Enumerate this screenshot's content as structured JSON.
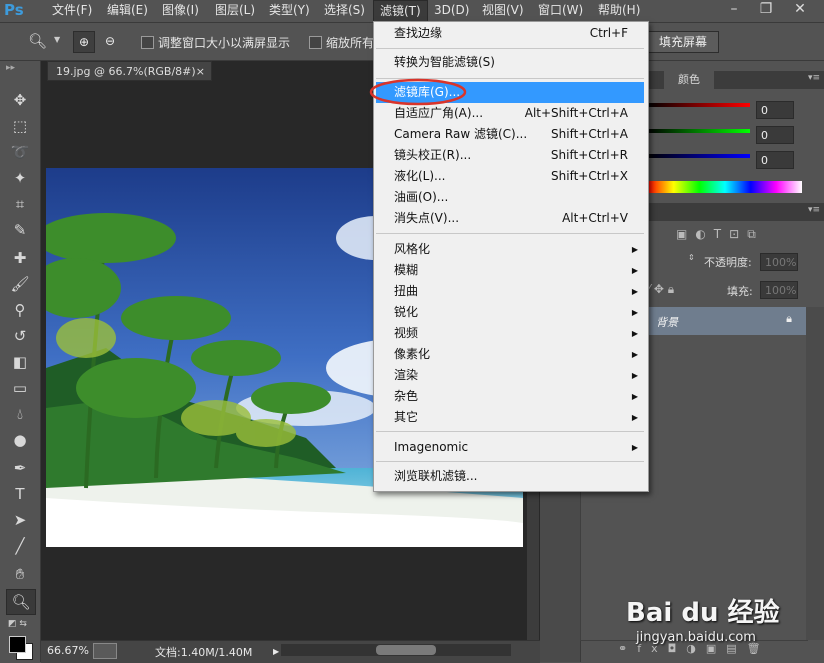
{
  "menubar": {
    "logo": "Ps",
    "items": [
      "文件(F)",
      "编辑(E)",
      "图像(I)",
      "图层(L)",
      "类型(Y)",
      "选择(S)",
      "滤镜(T)",
      "3D(D)",
      "视图(V)",
      "窗口(W)",
      "帮助(H)"
    ],
    "active": "滤镜(T)"
  },
  "options": {
    "fit_window": "调整窗口大小以满屏显示",
    "zoom_all": "缩放所有",
    "fill_screen": "填充屏幕"
  },
  "document": {
    "tab_title": "19.jpg @ 66.7%(RGB/8#)",
    "close_glyph": "×"
  },
  "status": {
    "zoom": "66.67%",
    "doc_info": "文档:1.40M/1.40M"
  },
  "color_panel": {
    "tab": "颜色",
    "r": "0",
    "g": "0",
    "b": "0"
  },
  "layers_panel": {
    "opacity_label": "不透明度:",
    "opacity_value": "100%",
    "fill_label": "填充:",
    "fill_value": "100%",
    "layer_name": "背景"
  },
  "filter_menu": {
    "groups": [
      [
        {
          "label": "查找边缘",
          "shortcut": "Ctrl+F"
        }
      ],
      [
        {
          "label": "转换为智能滤镜(S)",
          "shortcut": ""
        }
      ],
      [
        {
          "label": "滤镜库(G)...",
          "shortcut": ""
        },
        {
          "label": "自适应广角(A)...",
          "shortcut": "Alt+Shift+Ctrl+A"
        },
        {
          "label": "Camera Raw 滤镜(C)...",
          "shortcut": "Shift+Ctrl+A"
        },
        {
          "label": "镜头校正(R)...",
          "shortcut": "Shift+Ctrl+R"
        },
        {
          "label": "液化(L)...",
          "shortcut": "Shift+Ctrl+X"
        },
        {
          "label": "油画(O)...",
          "shortcut": ""
        },
        {
          "label": "消失点(V)...",
          "shortcut": "Alt+Ctrl+V"
        }
      ],
      [
        {
          "label": "风格化",
          "submenu": true
        },
        {
          "label": "模糊",
          "submenu": true
        },
        {
          "label": "扭曲",
          "submenu": true
        },
        {
          "label": "锐化",
          "submenu": true
        },
        {
          "label": "视频",
          "submenu": true
        },
        {
          "label": "像素化",
          "submenu": true
        },
        {
          "label": "渲染",
          "submenu": true
        },
        {
          "label": "杂色",
          "submenu": true
        },
        {
          "label": "其它",
          "submenu": true
        }
      ],
      [
        {
          "label": "Imagenomic",
          "submenu": true
        }
      ],
      [
        {
          "label": "浏览联机滤镜...",
          "shortcut": ""
        }
      ]
    ],
    "highlighted": "滤镜库(G)...",
    "highlight_color": "#3399ff",
    "annotation_color": "#d9342b"
  },
  "watermark": {
    "brand": "Bai du 经验",
    "url": "jingyan.baidu.com"
  }
}
